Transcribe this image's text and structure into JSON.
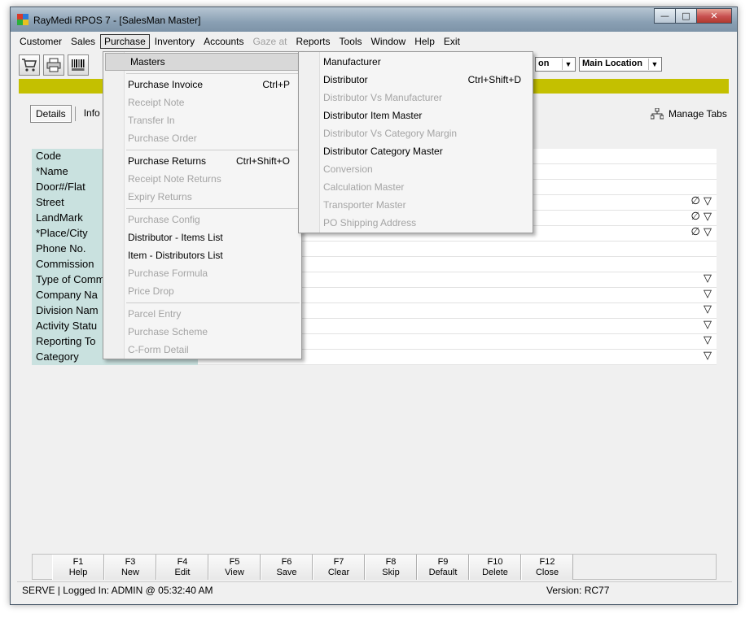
{
  "window": {
    "title": "RayMedi RPOS 7 - [SalesMan Master]",
    "minimize": "—",
    "maximize": "□",
    "close": "✕"
  },
  "menubar": [
    {
      "label": "Customer",
      "disabled": false
    },
    {
      "label": "Sales",
      "disabled": false
    },
    {
      "label": "Purchase",
      "disabled": false,
      "active": true
    },
    {
      "label": "Inventory",
      "disabled": false
    },
    {
      "label": "Accounts",
      "disabled": false
    },
    {
      "label": "Gaze at",
      "disabled": true
    },
    {
      "label": "Reports",
      "disabled": false
    },
    {
      "label": "Tools",
      "disabled": false
    },
    {
      "label": "Window",
      "disabled": false
    },
    {
      "label": "Help",
      "disabled": false
    },
    {
      "label": "Exit",
      "disabled": false
    }
  ],
  "toolbar": {
    "icons": [
      "cart-icon",
      "printer-icon",
      "barcode-icon"
    ],
    "combo1": "on",
    "combo2": "Main Location"
  },
  "tabs": [
    "Details",
    "Info"
  ],
  "manage_tabs": "Manage Tabs",
  "form": {
    "rows": [
      {
        "label": "Code",
        "ind": ""
      },
      {
        "label": "*Name",
        "ind": ""
      },
      {
        "label": "Door#/Flat",
        "ind": ""
      },
      {
        "label": "Street",
        "ind": "∅ ▽"
      },
      {
        "label": "LandMark",
        "ind": "∅ ▽"
      },
      {
        "label": "*Place/City",
        "ind": "∅ ▽"
      },
      {
        "label": "Phone No.",
        "ind": ""
      },
      {
        "label": "Commission",
        "ind": ""
      },
      {
        "label": "Type of Comm",
        "ind": "▽"
      },
      {
        "label": "Company Na",
        "ind": "▽"
      },
      {
        "label": "Division Nam",
        "ind": "▽"
      },
      {
        "label": "Activity Statu",
        "ind": "▽"
      },
      {
        "label": "Reporting To",
        "ind": "▽"
      },
      {
        "label": "Category",
        "ind": "▽"
      }
    ]
  },
  "purchase_menu": [
    {
      "label": "Masters",
      "shortcut": "",
      "disabled": false,
      "hl": true
    },
    {
      "sep": true
    },
    {
      "label": "Purchase Invoice",
      "shortcut": "Ctrl+P",
      "disabled": false
    },
    {
      "label": "Receipt Note",
      "shortcut": "",
      "disabled": true
    },
    {
      "label": "Transfer In",
      "shortcut": "",
      "disabled": true
    },
    {
      "label": "Purchase Order",
      "shortcut": "",
      "disabled": true
    },
    {
      "sep": true
    },
    {
      "label": "Purchase Returns",
      "shortcut": "Ctrl+Shift+O",
      "disabled": false
    },
    {
      "label": "Receipt Note Returns",
      "shortcut": "",
      "disabled": true
    },
    {
      "label": "Expiry Returns",
      "shortcut": "",
      "disabled": true
    },
    {
      "sep": true
    },
    {
      "label": "Purchase Config",
      "shortcut": "",
      "disabled": true
    },
    {
      "label": "Distributor - Items List",
      "shortcut": "",
      "disabled": false
    },
    {
      "label": "Item - Distributors List",
      "shortcut": "",
      "disabled": false
    },
    {
      "label": "Purchase Formula",
      "shortcut": "",
      "disabled": true
    },
    {
      "label": "Price Drop",
      "shortcut": "",
      "disabled": true
    },
    {
      "sep": true
    },
    {
      "label": "Parcel Entry",
      "shortcut": "",
      "disabled": true
    },
    {
      "label": "Purchase Scheme",
      "shortcut": "",
      "disabled": true
    },
    {
      "label": "C-Form Detail",
      "shortcut": "",
      "disabled": true
    }
  ],
  "masters_menu": [
    {
      "label": "Manufacturer",
      "shortcut": "",
      "disabled": false
    },
    {
      "label": "Distributor",
      "shortcut": "Ctrl+Shift+D",
      "disabled": false
    },
    {
      "label": "Distributor Vs Manufacturer",
      "shortcut": "",
      "disabled": true
    },
    {
      "label": "Distributor Item Master",
      "shortcut": "",
      "disabled": false
    },
    {
      "label": "Distributor Vs Category Margin",
      "shortcut": "",
      "disabled": true
    },
    {
      "label": "Distributor Category Master",
      "shortcut": "",
      "disabled": false
    },
    {
      "label": "Conversion",
      "shortcut": "",
      "disabled": true
    },
    {
      "label": "Calculation Master",
      "shortcut": "",
      "disabled": true
    },
    {
      "label": "Transporter Master",
      "shortcut": "",
      "disabled": true
    },
    {
      "label": "PO Shipping Address",
      "shortcut": "",
      "disabled": true
    }
  ],
  "fkeys": [
    {
      "key": "F1",
      "label": "Help"
    },
    {
      "key": "F3",
      "label": "New"
    },
    {
      "key": "F4",
      "label": "Edit"
    },
    {
      "key": "F5",
      "label": "View"
    },
    {
      "key": "F6",
      "label": "Save"
    },
    {
      "key": "F7",
      "label": "Clear"
    },
    {
      "key": "F8",
      "label": "Skip"
    },
    {
      "key": "F9",
      "label": "Default"
    },
    {
      "key": "F10",
      "label": "Delete"
    },
    {
      "key": "F12",
      "label": "Close"
    }
  ],
  "status": {
    "left": "SERVE |   Logged In: ADMIN  @ 05:32:40 AM",
    "version": "Version: RC77"
  },
  "colors": {
    "banner": "#c4c000",
    "label_bg": "#c9e1df"
  }
}
